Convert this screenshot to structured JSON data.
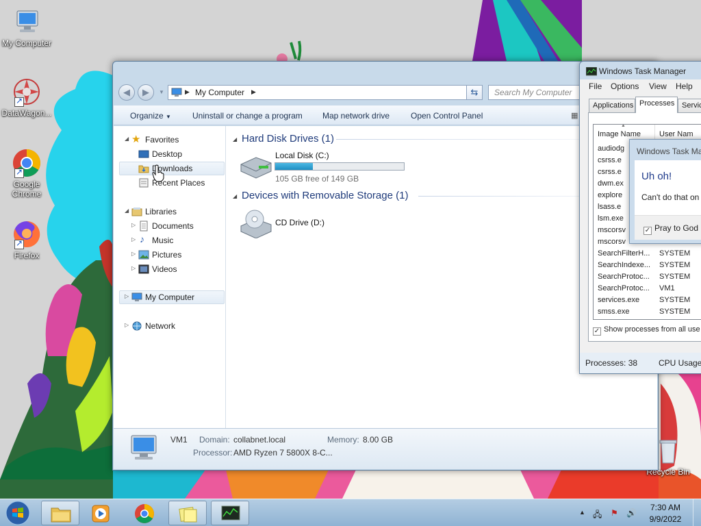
{
  "desktop": {
    "icons": [
      {
        "label": "My Computer",
        "icon": "computer-icon"
      },
      {
        "label": "DataWagon...",
        "icon": "datawagon-icon"
      },
      {
        "label": "Google Chrome",
        "icon": "chrome-icon"
      },
      {
        "label": "Firefox",
        "icon": "firefox-icon"
      },
      {
        "label": "Recycle Bin",
        "icon": "recycle-bin-icon"
      }
    ]
  },
  "explorer": {
    "breadcrumb": "My Computer",
    "search_placeholder": "Search My Computer",
    "toolbar": {
      "organize": "Organize",
      "uninstall": "Uninstall or change a program",
      "map_drive": "Map network drive",
      "control_panel": "Open Control Panel"
    },
    "nav": {
      "favorites": "Favorites",
      "desktop": "Desktop",
      "downloads": "Downloads",
      "recent_places": "Recent Places",
      "libraries": "Libraries",
      "documents": "Documents",
      "music": "Music",
      "pictures": "Pictures",
      "videos": "Videos",
      "my_computer": "My Computer",
      "network": "Network"
    },
    "groups": {
      "hard_disk": "Hard Disk Drives (1)",
      "removable": "Devices with Removable Storage (1)"
    },
    "drives": {
      "local_name": "Local Disk (C:)",
      "local_free": "105 GB free of 149 GB",
      "local_used_fraction": 0.295,
      "cd_name": "CD Drive (D:)"
    },
    "details": {
      "computer_name": "VM1",
      "domain_key": "Domain:",
      "domain_val": "collabnet.local",
      "memory_key": "Memory:",
      "memory_val": "8.00 GB",
      "processor_key": "Processor:",
      "processor_val": "AMD Ryzen 7 5800X 8-C..."
    }
  },
  "taskmgr": {
    "title": "Windows Task Manager",
    "menu": [
      "File",
      "Options",
      "View",
      "Help"
    ],
    "tabs": [
      "Applications",
      "Processes",
      "Servic"
    ],
    "columns": [
      "Image Name",
      "User Nam"
    ],
    "rows": [
      {
        "name": "audiodg",
        "user": ""
      },
      {
        "name": "csrss.e",
        "user": ""
      },
      {
        "name": "csrss.e",
        "user": ""
      },
      {
        "name": "dwm.ex",
        "user": ""
      },
      {
        "name": "explore",
        "user": ""
      },
      {
        "name": "lsass.e",
        "user": ""
      },
      {
        "name": "lsm.exe",
        "user": ""
      },
      {
        "name": "mscorsv",
        "user": ""
      },
      {
        "name": "mscorsv",
        "user": ""
      },
      {
        "name": "SearchFilterH...",
        "user": "SYSTEM"
      },
      {
        "name": "SearchIndexe...",
        "user": "SYSTEM"
      },
      {
        "name": "SearchProtoc...",
        "user": "SYSTEM"
      },
      {
        "name": "SearchProtoc...",
        "user": "VM1"
      },
      {
        "name": "services.exe",
        "user": "SYSTEM"
      },
      {
        "name": "smss.exe",
        "user": "SYSTEM"
      }
    ],
    "show_all": "Show processes from all use",
    "status_processes": "Processes: 38",
    "status_cpu": "CPU Usage:"
  },
  "dialog": {
    "title": "Windows Task Ma",
    "heading": "Uh oh!",
    "message": "Can't do that on",
    "checkbox": "Pray to God"
  },
  "tray": {
    "time": "7:30 AM",
    "date": "9/9/2022"
  }
}
